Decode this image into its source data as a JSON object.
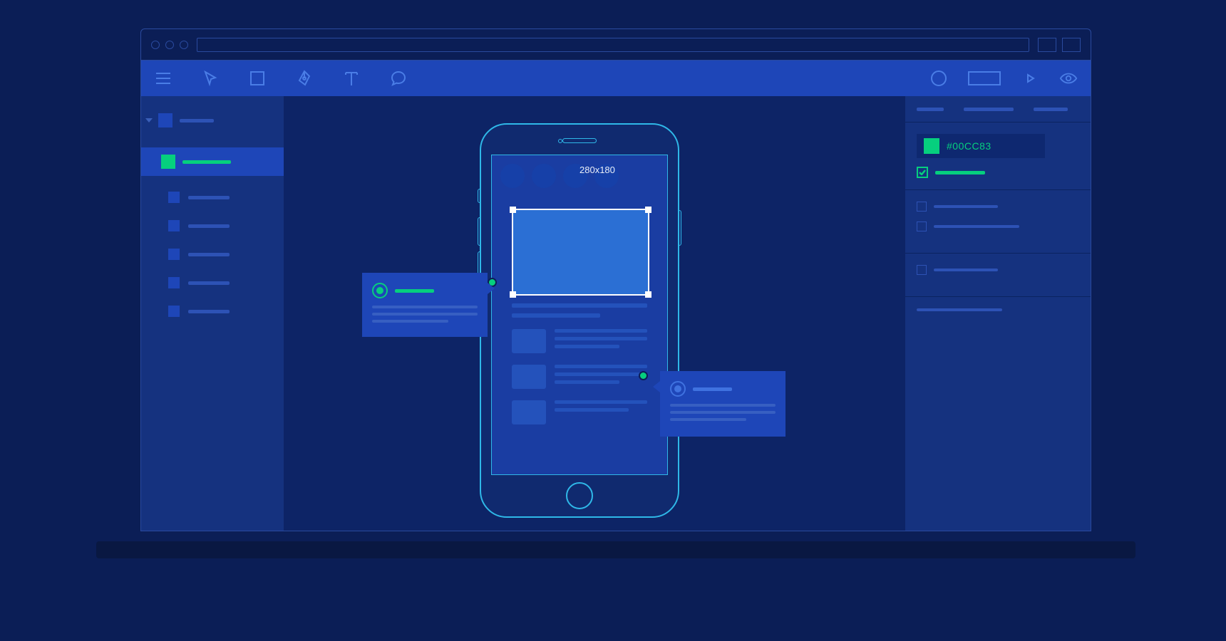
{
  "selection": {
    "dimensions_label": "280x180"
  },
  "inspector": {
    "color_hex": "#00CC83"
  },
  "colors": {
    "accent_green": "#06cf7e",
    "accent_blue": "#2b6fd4"
  }
}
